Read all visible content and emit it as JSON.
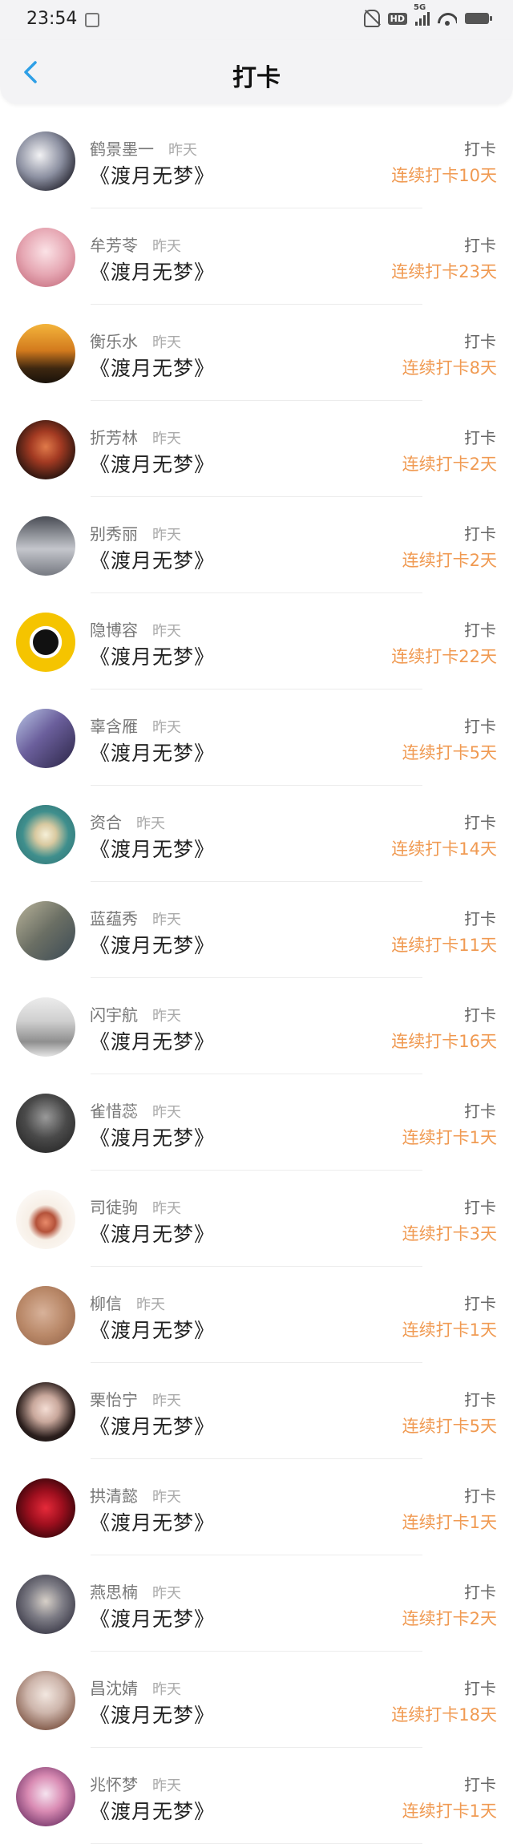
{
  "status_bar": {
    "time": "23:54",
    "network": "5G"
  },
  "header": {
    "title": "打卡"
  },
  "colors": {
    "streak": "#f09a52",
    "back_arrow": "#2e9fe6"
  },
  "records": [
    {
      "name": "鹤景墨一",
      "time": "昨天",
      "book": "《渡月无梦》",
      "action": "打卡",
      "streak": "连续打卡10天",
      "avatar_bg": "radial-gradient(circle at 40% 40%, #f2f2f4 0%, #8b8fa0 45%, #2b2b36 80%)"
    },
    {
      "name": "牟芳苓",
      "time": "昨天",
      "book": "《渡月无梦》",
      "action": "打卡",
      "streak": "连续打卡23天",
      "avatar_bg": "radial-gradient(circle at 50% 40%, #fbe2e6 0%, #e6a7b3 50%, #c56d7e 90%)"
    },
    {
      "name": "衡乐水",
      "time": "昨天",
      "book": "《渡月无梦》",
      "action": "打卡",
      "streak": "连续打卡8天",
      "avatar_bg": "linear-gradient(180deg, #f4b43b 0%, #d27a1d 45%, #3d2710 75%, #1a120a 100%)"
    },
    {
      "name": "折芳林",
      "time": "昨天",
      "book": "《渡月无梦》",
      "action": "打卡",
      "streak": "连续打卡2天",
      "avatar_bg": "radial-gradient(circle at 50% 45%, #e07a4a 0%, #a33a22 35%, #3a1a12 70%, #130a08 100%)"
    },
    {
      "name": "别秀丽",
      "time": "昨天",
      "book": "《渡月无梦》",
      "action": "打卡",
      "streak": "连续打卡2天",
      "avatar_bg": "linear-gradient(180deg, #4a4d55 0%, #c4c6cc 55%, #777a82 100%)"
    },
    {
      "name": "隐博容",
      "time": "昨天",
      "book": "《渡月无梦》",
      "action": "打卡",
      "streak": "连续打卡22天",
      "avatar_bg": "radial-gradient(circle at 50% 50%, #111 0%, #111 30%, #ffffff 31%, #ffffff 38%, #f5c400 39%, #f5c400 100%)"
    },
    {
      "name": "辜含雁",
      "time": "昨天",
      "book": "《渡月无梦》",
      "action": "打卡",
      "streak": "连续打卡5天",
      "avatar_bg": "linear-gradient(135deg, #b9c6e6 0%, #6b5f9c 45%, #2b2546 100%)"
    },
    {
      "name": "资合",
      "time": "昨天",
      "book": "《渡月无梦》",
      "action": "打卡",
      "streak": "连续打卡14天",
      "avatar_bg": "radial-gradient(circle at 50% 50%, #f6f0d8 0%, #d8c9a0 25%, #3f8f8d 55%, #2d6d70 100%)"
    },
    {
      "name": "蓝蕴秀",
      "time": "昨天",
      "book": "《渡月无梦》",
      "action": "打卡",
      "streak": "连续打卡11天",
      "avatar_bg": "linear-gradient(135deg, #b8b39a 0%, #6b6f64 50%, #3b4a55 100%)"
    },
    {
      "name": "闪宇航",
      "time": "昨天",
      "book": "《渡月无梦》",
      "action": "打卡",
      "streak": "连续打卡16天",
      "avatar_bg": "linear-gradient(180deg, #ececec 0%, #cfcfcf 40%, #8f8f8f 75%, #e5e5e5 100%)"
    },
    {
      "name": "雀惜蕊",
      "time": "昨天",
      "book": "《渡月无梦》",
      "action": "打卡",
      "streak": "连续打卡1天",
      "avatar_bg": "radial-gradient(circle at 50% 40%, #9a9a9a 0%, #4a4a4a 45%, #1c1c1c 100%)"
    },
    {
      "name": "司徒驹",
      "time": "昨天",
      "book": "《渡月无梦》",
      "action": "打卡",
      "streak": "连续打卡3天",
      "avatar_bg": "radial-gradient(circle at 50% 55%, #e98a6a 0%, #b4523a 22%, #f7efe6 40%, #ffffff 100%)"
    },
    {
      "name": "柳信",
      "time": "昨天",
      "book": "《渡月无梦》",
      "action": "打卡",
      "streak": "连续打卡1天",
      "avatar_bg": "radial-gradient(circle at 45% 45%, #d8b29a 0%, #b98868 50%, #8c5e44 100%)"
    },
    {
      "name": "栗怡宁",
      "time": "昨天",
      "book": "《渡月无梦》",
      "action": "打卡",
      "streak": "连续打卡5天",
      "avatar_bg": "radial-gradient(circle at 50% 45%, #f4ddd4 0%, #c9a89c 30%, #2a1e1c 65%, #111 100%)"
    },
    {
      "name": "拱清懿",
      "time": "昨天",
      "book": "《渡月无梦》",
      "action": "打卡",
      "streak": "连续打卡1天",
      "avatar_bg": "radial-gradient(circle at 50% 50%, #e62a3a 0%, #9e0f1e 40%, #2a0408 85%, #000 100%)"
    },
    {
      "name": "燕思楠",
      "time": "昨天",
      "book": "《渡月无梦》",
      "action": "打卡",
      "streak": "连续打卡2天",
      "avatar_bg": "radial-gradient(circle at 50% 45%, #d7d0c8 0%, #7d7c85 40%, #3b3a48 80%)"
    },
    {
      "name": "昌沈婧",
      "time": "昨天",
      "book": "《渡月无梦》",
      "action": "打卡",
      "streak": "连续打卡18天",
      "avatar_bg": "radial-gradient(circle at 50% 40%, #f2e7e0 0%, #cdb5ab 40%, #8a6454 75%, #5a3a30 100%)"
    },
    {
      "name": "兆怀梦",
      "time": "昨天",
      "book": "《渡月无梦》",
      "action": "打卡",
      "streak": "连续打卡1天",
      "avatar_bg": "radial-gradient(circle at 50% 45%, #f5e3ef 0%, #d98bb3 40%, #7a3b6e 80%)"
    }
  ]
}
